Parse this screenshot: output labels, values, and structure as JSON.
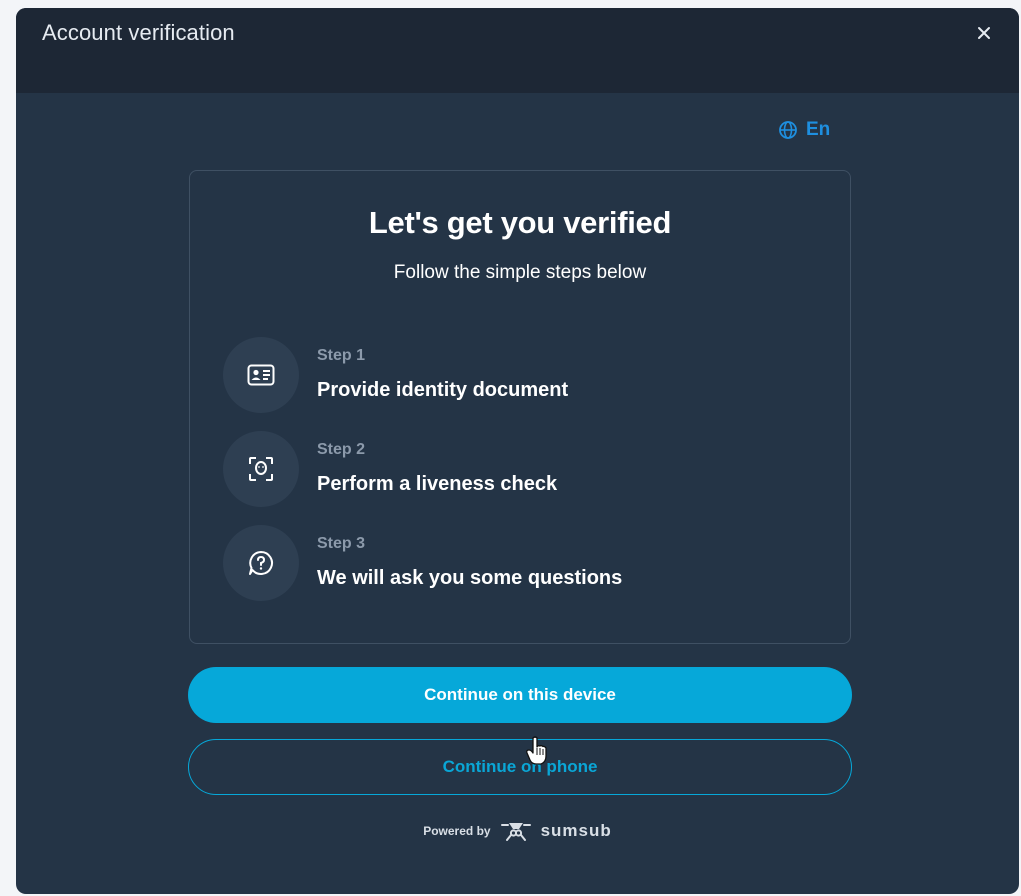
{
  "window": {
    "title": "Account verification",
    "close_icon": "close-icon"
  },
  "language": {
    "icon": "globe-icon",
    "label": "En"
  },
  "card": {
    "title": "Let's get you verified",
    "subtitle": "Follow the simple steps below",
    "steps": [
      {
        "number": "Step 1",
        "text": "Provide identity document",
        "icon": "id-card-icon"
      },
      {
        "number": "Step 2",
        "text": "Perform a liveness check",
        "icon": "face-scan-icon"
      },
      {
        "number": "Step 3",
        "text": "We will ask you some questions",
        "icon": "question-icon"
      }
    ]
  },
  "actions": {
    "primary_label": "Continue on this device",
    "secondary_label": "Continue on phone"
  },
  "footer": {
    "powered_by": "Powered by",
    "brand": "sumsub"
  },
  "colors": {
    "modal_bg": "#243446",
    "header_bg": "#1d2735",
    "accent": "#06a8d9",
    "link": "#1e8fe0"
  }
}
